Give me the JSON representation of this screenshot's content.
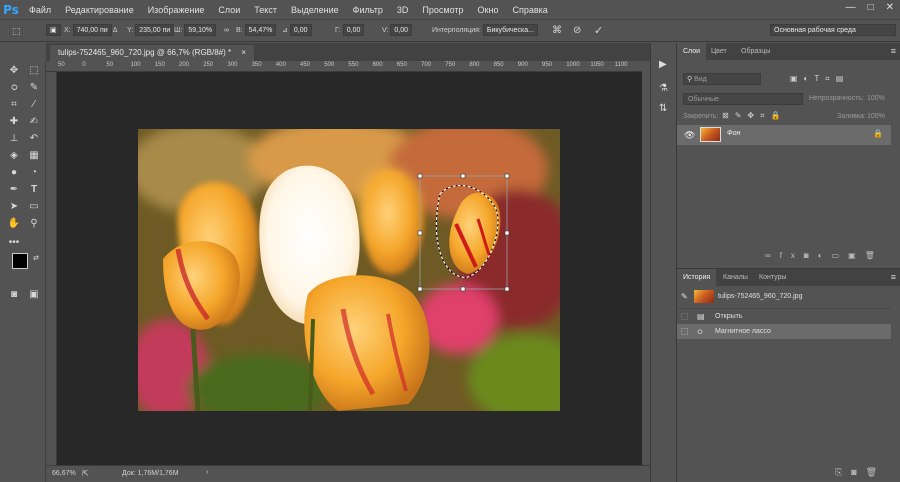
{
  "app": {
    "logo": "Ps",
    "window_controls": [
      "—",
      "□",
      "✕"
    ]
  },
  "menu": [
    "Файл",
    "Редактирование",
    "Изображение",
    "Слои",
    "Текст",
    "Выделение",
    "Фильтр",
    "3D",
    "Просмотр",
    "Окно",
    "Справка"
  ],
  "options": {
    "x_label": "X:",
    "x_value": "740,00 пи",
    "y_label": "Y:",
    "y_value": "235,00 пи",
    "w_label": "Ш:",
    "w_value": "59,10%",
    "h_label": "В:",
    "h_value": "54,47%",
    "angle_value": "0,00",
    "hskew_label": "Г:",
    "hskew_value": "0,00",
    "vskew_label": "V:",
    "vskew_value": "0,00",
    "interp_label": "Интерполяция:",
    "interp_value": "Бикубическа...",
    "workspace": "Основная рабочая среда"
  },
  "document_tab": {
    "title": "tulips-752465_960_720.jpg @ 66,7% (RGB/8#) *",
    "close": "×"
  },
  "ruler_ticks": [
    "50",
    "0",
    "50",
    "100",
    "150",
    "200",
    "250",
    "300",
    "350",
    "400",
    "450",
    "500",
    "550",
    "600",
    "650",
    "700",
    "750",
    "800",
    "850",
    "900",
    "950",
    "1000",
    "1050",
    "1100"
  ],
  "status": {
    "zoom": "66,67%",
    "doc": "Док: 1,76M/1,76M"
  },
  "layers_panel": {
    "tabs": [
      "Слои",
      "Цвет",
      "Образцы"
    ],
    "search_placeholder": "Вид",
    "blend_mode": "Обычные",
    "opacity_label": "Непрозрачность:",
    "opacity_value": "100%",
    "lock_label": "Закрепить:",
    "fill_label": "Заливка:",
    "fill_value": "100%",
    "layers": [
      {
        "name": "Фон"
      }
    ]
  },
  "history_panel": {
    "tabs": [
      "История",
      "Каналы",
      "Контуры"
    ],
    "snapshot": "tulips-752465_960_720.jpg",
    "items": [
      "Открыть",
      "Магнитное лассо"
    ]
  },
  "colors": {
    "accent": "#31a8ff",
    "panel_bg": "#535353",
    "canvas_bg": "#282828",
    "selected_row": "#6b6b6b"
  }
}
